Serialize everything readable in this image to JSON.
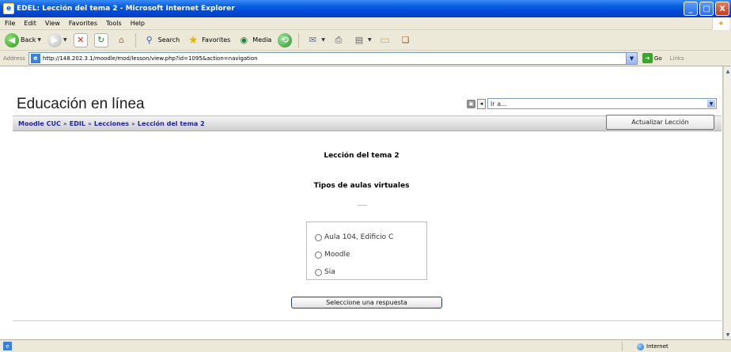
{
  "window": {
    "title": "EDEL: Lección del tema 2 - Microsoft Internet Explorer",
    "controls": {
      "minimize": "_",
      "maximize": "□",
      "close": "X"
    }
  },
  "menu": [
    "File",
    "Edit",
    "View",
    "Favorites",
    "Tools",
    "Help"
  ],
  "toolbar": {
    "back_label": "Back",
    "search_label": "Search",
    "favorites_label": "Favorites",
    "media_label": "Media"
  },
  "address": {
    "label": "Address",
    "url": "http://148.202.3.1/moodle/mod/lesson/view.php?id=1095&action=navigation",
    "go_label": "Go",
    "links_label": "Links"
  },
  "page": {
    "site_title": "Educación en línea",
    "jump_placeholder": "Ir a...",
    "breadcrumbs": [
      "Moodle CUC",
      "EDIL",
      "Lecciones",
      "Lección del tema 2"
    ],
    "breadcrumb_separator": "»",
    "update_button": "Actualizar Lección",
    "lesson_title": "Lección del tema 2",
    "question": "Tipos de aulas virtuales",
    "answers": [
      "Aula 104, Edificio C",
      "Moodle",
      "Sia"
    ],
    "submit_button": "Seleccione una respuesta"
  },
  "status": {
    "zone": "Internet"
  }
}
